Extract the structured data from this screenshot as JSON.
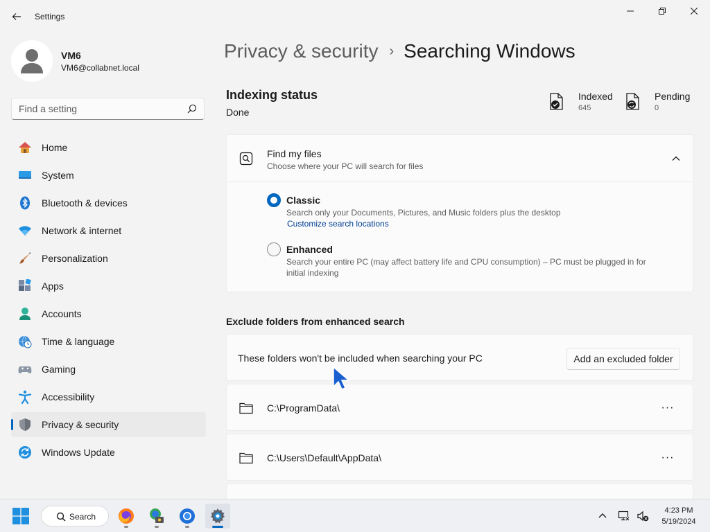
{
  "window": {
    "title": "Settings"
  },
  "user": {
    "name": "VM6",
    "email": "VM6@collabnet.local"
  },
  "search": {
    "placeholder": "Find a setting"
  },
  "nav": {
    "items": [
      {
        "label": "Home",
        "icon": "home-icon"
      },
      {
        "label": "System",
        "icon": "system-icon"
      },
      {
        "label": "Bluetooth & devices",
        "icon": "bluetooth-icon"
      },
      {
        "label": "Network & internet",
        "icon": "wifi-icon"
      },
      {
        "label": "Personalization",
        "icon": "brush-icon"
      },
      {
        "label": "Apps",
        "icon": "apps-icon"
      },
      {
        "label": "Accounts",
        "icon": "accounts-icon"
      },
      {
        "label": "Time & language",
        "icon": "globe-clock-icon"
      },
      {
        "label": "Gaming",
        "icon": "gamepad-icon"
      },
      {
        "label": "Accessibility",
        "icon": "accessibility-icon"
      },
      {
        "label": "Privacy & security",
        "icon": "shield-icon",
        "active": true
      },
      {
        "label": "Windows Update",
        "icon": "update-icon"
      }
    ]
  },
  "breadcrumb": {
    "parent": "Privacy & security",
    "separator": "›",
    "current": "Searching Windows"
  },
  "indexing": {
    "title": "Indexing status",
    "status": "Done",
    "indexed_label": "Indexed",
    "indexed_value": "645",
    "pending_label": "Pending",
    "pending_value": "0"
  },
  "find_my_files": {
    "title": "Find my files",
    "subtitle": "Choose where your PC will search for files",
    "options": [
      {
        "title": "Classic",
        "description": "Search only your Documents, Pictures, and Music folders plus the desktop",
        "link": "Customize search locations",
        "selected": true
      },
      {
        "title": "Enhanced",
        "description": "Search your entire PC (may affect battery life and CPU consumption) – PC must be plugged in for initial indexing",
        "selected": false
      }
    ]
  },
  "exclude": {
    "title": "Exclude folders from enhanced search",
    "text": "These folders won't be included when searching your PC",
    "button": "Add an excluded folder",
    "folders": [
      {
        "path": "C:\\ProgramData\\",
        "more": "···"
      },
      {
        "path": "C:\\Users\\Default\\AppData\\",
        "more": "···"
      }
    ]
  },
  "taskbar": {
    "search_label": "Search",
    "apps": [
      "firefox-icon",
      "network-app-icon",
      "chrome-icon",
      "settings-icon"
    ],
    "time": "4:23 PM",
    "date": "5/19/2024"
  },
  "colors": {
    "accent": "#0067c0",
    "background": "#f3f3f3",
    "card": "#fbfbfb"
  }
}
